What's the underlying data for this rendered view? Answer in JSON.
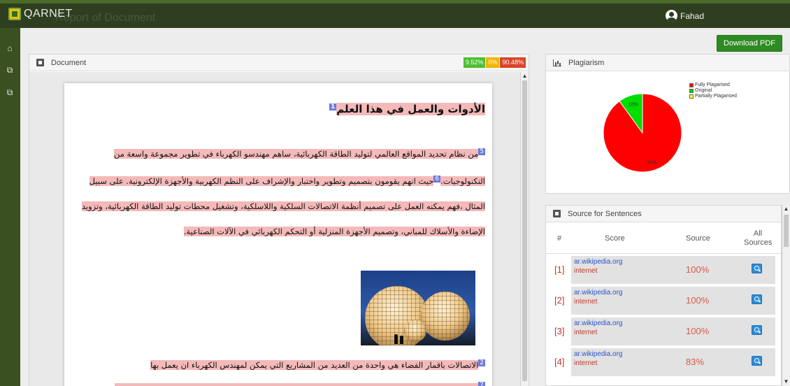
{
  "app": {
    "brand": "QARNET",
    "ghost_title": "Report of Document",
    "user_name": "Fahad"
  },
  "nav": {
    "icons": [
      "home-icon",
      "document-copy-icon",
      "document-copy-icon"
    ]
  },
  "toolbar": {
    "download_label": "Download PDF"
  },
  "document_panel": {
    "title": "Document",
    "badges": [
      {
        "label": "9.52%",
        "color": "#4fbe34"
      },
      {
        "label": "0%",
        "color": "#f0b400"
      },
      {
        "label": "90.48%",
        "color": "#d9452b"
      }
    ],
    "heading": {
      "text": "الأدوات والعمل في هذا العلم",
      "num": "1"
    },
    "paragraph_1": {
      "num_a": "5",
      "text_a": "من نظام تحديد المواقع العالمي لتوليد الطاقة الكهربائية، ساهم مهندسو الكهرباء في تطوير مجموعة واسعة من التكنولوجيات.",
      "num_b": "6",
      "text_b": "حيث انهم يقومون بتصميم وتطوير واختبار والإشراف على النظم الكهربية والأجهزة الإلكترونية. على سبيل المثال ،فهم يمكنه العمل على تصميم أنظمة الاتصالات السلكية واللاسلكية، وتشغيل محطات توليد الطاقة الكهربائية، وتزويد الإضاءة والأسلاك للمباني، وتصميم الأجهزة المنزلية أو التحكم الكهربائي في الآلات الصناعية."
    },
    "paragraph_2": {
      "num": "2",
      "text": "الاتصالات باقمار الفضاء هي واحدة من العديد من المشاريع التي يمكن لمهندس الكهرباء ان يعمل بها"
    },
    "paragraph_3": {
      "num": "7",
      "text": ""
    }
  },
  "plagiarism_panel": {
    "title": "Plagiarism",
    "legend": [
      {
        "label": "Fully Plagarised",
        "color": "#ff0000"
      },
      {
        "label": "Original",
        "color": "#00cc00"
      },
      {
        "label": "Partially Plagarised",
        "color": "#ffff33"
      }
    ]
  },
  "chart_data": {
    "type": "pie",
    "slices": [
      {
        "name": "Fully Plagarised",
        "value": 90,
        "label": "90%",
        "color": "#ff0000"
      },
      {
        "name": "Original",
        "value": 10,
        "label": "10%",
        "color": "#00dd00"
      },
      {
        "name": "Partially Plagarised",
        "value": 0,
        "label": "",
        "color": "#ffff33"
      }
    ],
    "legend_position": "top-right"
  },
  "sources_panel": {
    "title": "Source for Sentences",
    "columns": [
      "#",
      "Score",
      "Source",
      "All Sources"
    ],
    "rows": [
      {
        "no": "[1]",
        "site": "ar.wikipedia.org",
        "type": "internet",
        "score": "100%"
      },
      {
        "no": "[2]",
        "site": "ar.wikipedia.org",
        "type": "internet",
        "score": "100%"
      },
      {
        "no": "[3]",
        "site": "ar.wikipedia.org",
        "type": "internet",
        "score": "100%"
      },
      {
        "no": "[4]",
        "site": "ar.wikipedia.org",
        "type": "internet",
        "score": "83%"
      }
    ]
  }
}
